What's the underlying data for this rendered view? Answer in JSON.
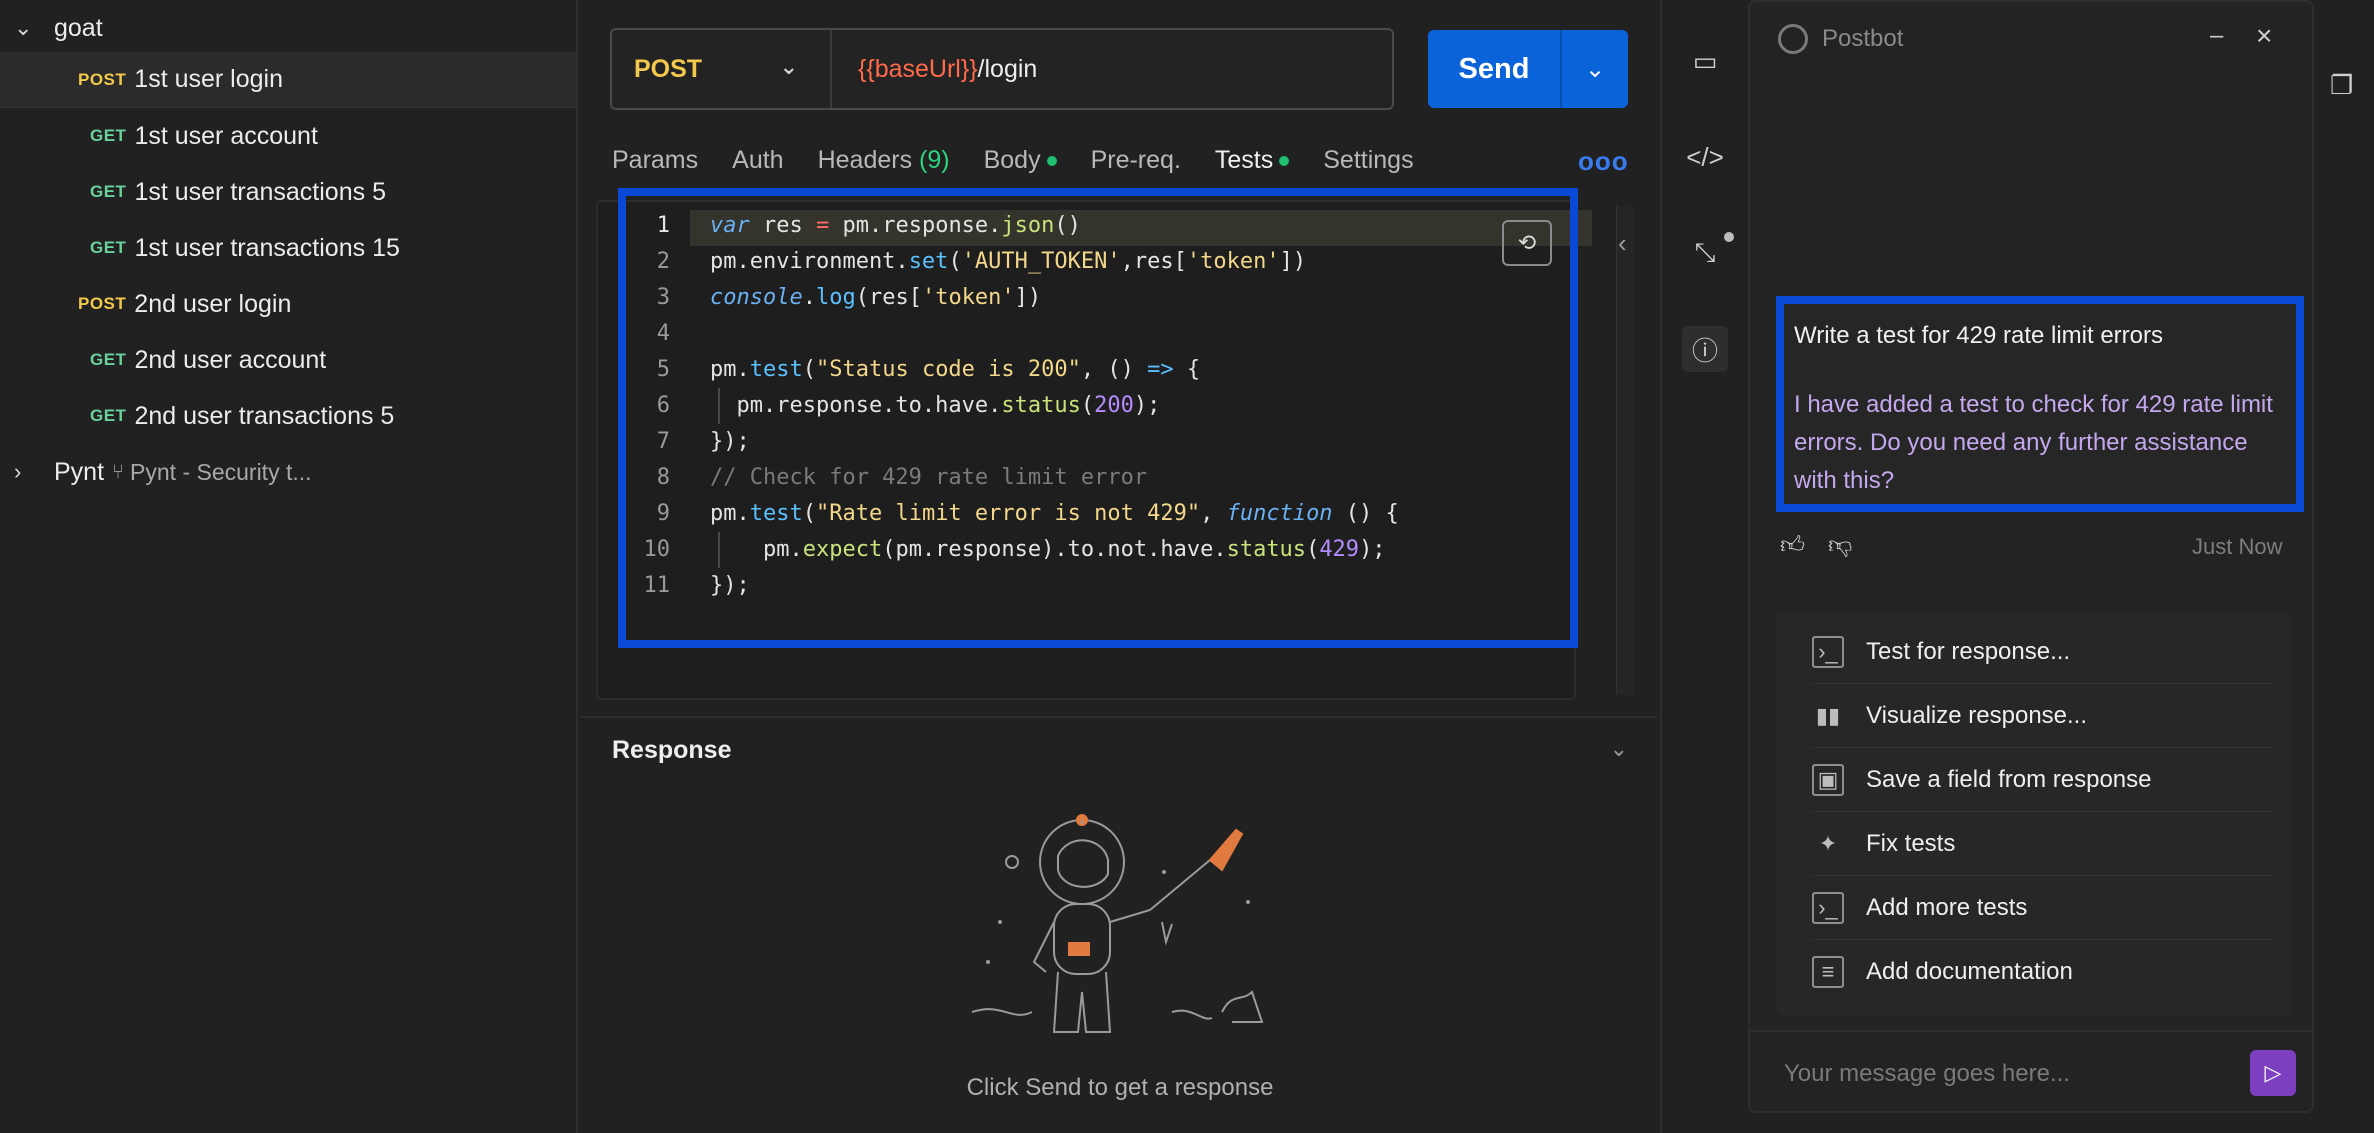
{
  "sidebar": {
    "collection_name": "goat",
    "requests": [
      {
        "method": "POST",
        "name": "1st user login"
      },
      {
        "method": "GET",
        "name": "1st user account"
      },
      {
        "method": "GET",
        "name": "1st user transactions 5"
      },
      {
        "method": "GET",
        "name": "1st user transactions 15"
      },
      {
        "method": "POST",
        "name": "2nd user login"
      },
      {
        "method": "GET",
        "name": "2nd user account"
      },
      {
        "method": "GET",
        "name": "2nd user transactions 5"
      }
    ],
    "pynt": {
      "name": "Pynt",
      "subtitle": "Pynt - Security t..."
    }
  },
  "request": {
    "method": "POST",
    "url_var": "{{baseUrl}}",
    "url_path": "/login",
    "send_label": "Send"
  },
  "tabs": {
    "params": "Params",
    "auth": "Auth",
    "headers": "Headers",
    "headers_count": "(9)",
    "body": "Body",
    "prereq": "Pre-req.",
    "tests": "Tests",
    "settings": "Settings",
    "more": "ooo"
  },
  "editor": {
    "line_numbers": [
      "1",
      "2",
      "3",
      "4",
      "5",
      "6",
      "7",
      "8",
      "9",
      "10",
      "11"
    ],
    "comment_line": "// Check for 429 rate limit error"
  },
  "response": {
    "title": "Response",
    "hint": "Click Send to get a response"
  },
  "postbot": {
    "title": "Postbot",
    "user_message": "Write a test for 429 rate limit errors",
    "bot_reply": "I have added a test to check for 429 rate limit errors. Do you need any further assistance with this?",
    "timestamp": "Just Now",
    "suggestions": [
      {
        "label": "Test for response...",
        "icon": "terminal-icon"
      },
      {
        "label": "Visualize response...",
        "icon": "bar-chart-icon"
      },
      {
        "label": "Save a field from response",
        "icon": "save-icon"
      },
      {
        "label": "Fix tests",
        "icon": "sparkle-icon"
      },
      {
        "label": "Add more tests",
        "icon": "terminal-icon"
      },
      {
        "label": "Add documentation",
        "icon": "document-icon"
      }
    ],
    "input_placeholder": "Your message goes here..."
  },
  "colors": {
    "accent": "#0a63d8",
    "highlight_border": "#0a48d6",
    "post": "#f2c94c",
    "get": "#6bd19a",
    "postbot_reply": "#c4a8ee"
  }
}
